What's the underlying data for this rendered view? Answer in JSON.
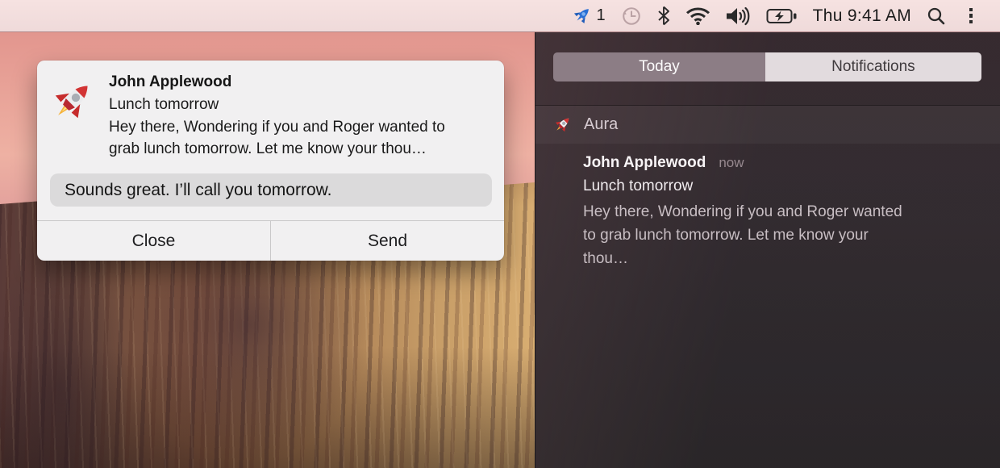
{
  "menu_bar": {
    "app_badge_count": "1",
    "time": "Thu 9:41 AM",
    "status_icons": [
      "aura-rocket-icon",
      "time-machine-icon",
      "bluetooth-icon",
      "wifi-icon",
      "volume-icon",
      "battery-charging-icon",
      "spotlight-search-icon",
      "notification-center-icon"
    ]
  },
  "alert": {
    "app_icon": "rocket-icon",
    "title": "John Applewood",
    "subtitle": "Lunch tomorrow",
    "body_lines": [
      "Hey there, Wondering if you and Roger wanted to",
      "grab lunch tomorrow. Let me know your thou…"
    ],
    "reply_value": "Sounds great. I’ll call you tomorrow.",
    "close_label": "Close",
    "send_label": "Send"
  },
  "notification_center": {
    "tabs": {
      "today": "Today",
      "notifications": "Notifications",
      "selected": "Notifications"
    },
    "group": {
      "app_name": "Aura",
      "app_icon": "rocket-icon"
    },
    "notification": {
      "title": "John Applewood",
      "time": "now",
      "subtitle": "Lunch tomorrow",
      "body_lines": [
        "Hey there, Wondering if you and Roger wanted",
        "to grab lunch tomorrow. Let me know your",
        "thou…"
      ]
    }
  },
  "colors": {
    "menu_bar_bg": "#f3dedd",
    "panel_bg": "#352c31",
    "alert_bg": "#f1f0f1",
    "reply_field_bg": "#dbdadb",
    "segment_selected_bg": "#e2dbde",
    "segment_unselected_bg": "#8c7d85",
    "rocket_red": "#cf2e2e",
    "rocket_blue": "#2a6fd4"
  }
}
